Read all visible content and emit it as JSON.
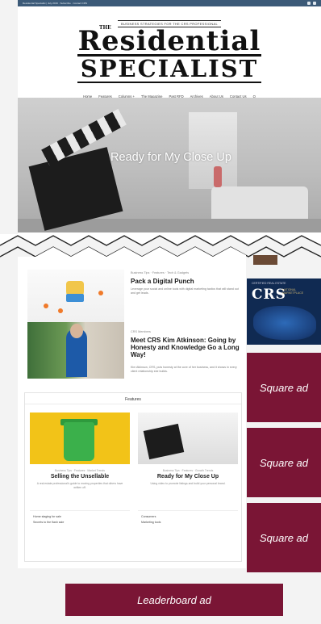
{
  "topbar": {
    "text": "Residential Specialist | July 2019 · Subscribe · Contact CRS"
  },
  "masthead": {
    "tagline": "BUSINESS STRATEGIES FOR THE CRS PROFESSIONAL",
    "logo_the": "THE",
    "logo_line1": "Residential",
    "logo_line2": "SPECIALIST"
  },
  "nav": {
    "items": [
      "Home",
      "Features",
      "Columns +",
      "The Magazine",
      "Past RFD",
      "Archives",
      "About Us",
      "Contact Us",
      "Q"
    ]
  },
  "hero": {
    "title": "Ready for My Close Up"
  },
  "posts": [
    {
      "meta": "Business Tips · Features · Tech & Gadgets",
      "title": "Pack a Digital Punch",
      "excerpt": "Leverage your social and online tools with digital marketing tactics that will stand out and get leads."
    },
    {
      "meta": "CRS Members",
      "title": "Meet CRS Kim Atkinson: Going by Honesty and Knowledge Go a Long Way!",
      "excerpt": "Kim Atkinson, CRS, puts honesty at the core of her business, and it shows in every client relationship she builds."
    }
  ],
  "features": {
    "heading": "Features",
    "items": [
      {
        "meta": "Business Tips · Features · Market Trends",
        "title": "Selling the Unsellable",
        "excerpt": "A real estate professional’s guide to moving properties that others have written off."
      },
      {
        "meta": "Business Tips · Features · Growth Trends",
        "title": "Ready for My Close Up",
        "excerpt": "Using video to promote listings and build your personal brand."
      }
    ],
    "links_left": [
      "Home staging for sale",
      "Secrets to the flash sale"
    ],
    "links_right": [
      "Consumers",
      "Marketing tools"
    ]
  },
  "ads": {
    "crs_small": "CERTIFIED REAL ESTATE",
    "crs_logo": "CRS",
    "crs_sub": "NATIONAL MARKETPLACE",
    "square_1": "Square ad",
    "square_2": "Square ad",
    "square_3": "Square ad",
    "leaderboard": "Leaderboard ad"
  },
  "colors": {
    "ad_maroon": "#7a1535",
    "topbar": "#3c5a78",
    "crs_navy": "#102a52"
  }
}
